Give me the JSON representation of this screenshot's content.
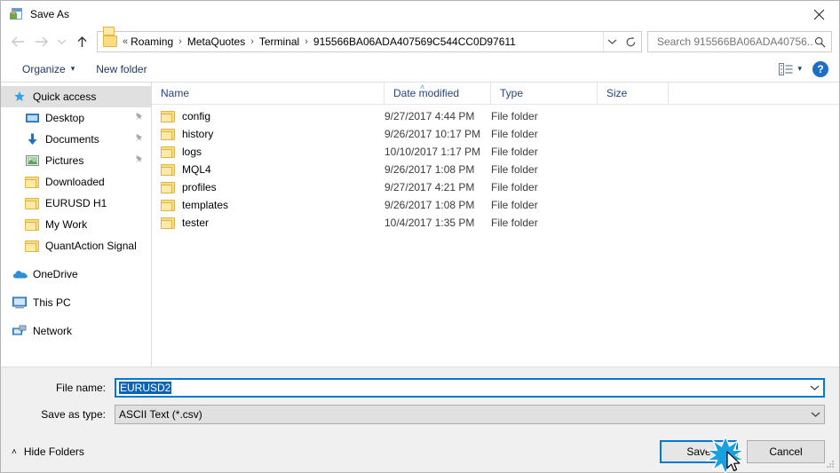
{
  "window": {
    "title": "Save As",
    "app_icon": "save-as-icon",
    "close_icon": "close-icon"
  },
  "nav": {
    "back_icon": "arrow-left-icon",
    "forward_icon": "arrow-right-icon",
    "recent_icon": "chevron-down-icon",
    "up_icon": "arrow-up-icon",
    "refresh_icon": "refresh-icon",
    "dropdown_icon": "chevron-down-icon",
    "folder_icon": "folder-icon",
    "overflow": "«",
    "separator": "›",
    "breadcrumbs": [
      "Roaming",
      "MetaQuotes",
      "Terminal",
      "915566BA06ADA407569C544CC0D97611"
    ]
  },
  "search": {
    "placeholder": "Search 915566BA06ADA40756...",
    "value": "",
    "icon": "search-icon"
  },
  "toolbar": {
    "organize_label": "Organize",
    "organize_caret": "▾",
    "new_folder_label": "New folder",
    "view_icon": "view-layout-icon",
    "view_caret": "▾",
    "help_label": "?",
    "help_icon": "help-icon"
  },
  "sidebar": {
    "items": [
      {
        "label": "Quick access",
        "icon": "star-icon",
        "level": "root",
        "selected": true,
        "pinned": false
      },
      {
        "label": "Desktop",
        "icon": "monitor-icon",
        "level": "indent",
        "selected": false,
        "pinned": true
      },
      {
        "label": "Documents",
        "icon": "download-icon",
        "level": "indent",
        "selected": false,
        "pinned": true
      },
      {
        "label": "Pictures",
        "icon": "picture-icon",
        "level": "indent",
        "selected": false,
        "pinned": true
      },
      {
        "label": "Downloaded",
        "icon": "folder-icon",
        "level": "indent",
        "selected": false,
        "pinned": false
      },
      {
        "label": "EURUSD H1",
        "icon": "folder-icon",
        "level": "indent",
        "selected": false,
        "pinned": false
      },
      {
        "label": "My Work",
        "icon": "folder-icon",
        "level": "indent",
        "selected": false,
        "pinned": false
      },
      {
        "label": "QuantAction Signal",
        "icon": "folder-icon",
        "level": "indent",
        "selected": false,
        "pinned": false
      },
      {
        "label": "OneDrive",
        "icon": "cloud-icon",
        "level": "root",
        "selected": false,
        "pinned": false,
        "gap_before": true
      },
      {
        "label": "This PC",
        "icon": "computer-icon",
        "level": "root",
        "selected": false,
        "pinned": false,
        "gap_before": true
      },
      {
        "label": "Network",
        "icon": "network-icon",
        "level": "root",
        "selected": false,
        "pinned": false,
        "gap_before": true
      }
    ]
  },
  "file_list": {
    "columns": [
      "Name",
      "Date modified",
      "Type",
      "Size"
    ],
    "sort_column": "Name",
    "sort_caret": "˄",
    "rows": [
      {
        "name": "config",
        "date": "9/27/2017 4:44 PM",
        "type": "File folder",
        "size": "",
        "icon": "folder-icon"
      },
      {
        "name": "history",
        "date": "9/26/2017 10:17 PM",
        "type": "File folder",
        "size": "",
        "icon": "folder-icon"
      },
      {
        "name": "logs",
        "date": "10/10/2017 1:17 PM",
        "type": "File folder",
        "size": "",
        "icon": "folder-icon"
      },
      {
        "name": "MQL4",
        "date": "9/26/2017 1:08 PM",
        "type": "File folder",
        "size": "",
        "icon": "folder-icon"
      },
      {
        "name": "profiles",
        "date": "9/27/2017 4:21 PM",
        "type": "File folder",
        "size": "",
        "icon": "folder-icon"
      },
      {
        "name": "templates",
        "date": "9/26/2017 1:08 PM",
        "type": "File folder",
        "size": "",
        "icon": "folder-icon"
      },
      {
        "name": "tester",
        "date": "10/4/2017 1:35 PM",
        "type": "File folder",
        "size": "",
        "icon": "folder-icon"
      }
    ]
  },
  "form": {
    "file_name_label": "File name:",
    "file_name_value": "EURUSD2",
    "file_name_selected": true,
    "save_as_type_label": "Save as type:",
    "save_as_type_value": "ASCII Text (*.csv)",
    "dropdown_icon": "chevron-down-icon"
  },
  "footer": {
    "hide_folders_label": "Hide Folders",
    "hide_folders_caret": "˄",
    "save_label": "Save",
    "cancel_label": "Cancel",
    "resize_grip": "resize-grip-icon",
    "cursor": "mouse-pointer-icon",
    "click_effect": "click-burst-icon"
  },
  "colors": {
    "accent": "#0078d7",
    "selection": "#0a63b8",
    "header_text": "#26467a",
    "toolbar_text": "#1f3864",
    "folder": "#fddc7e",
    "help_blue": "#1d6fc4"
  }
}
